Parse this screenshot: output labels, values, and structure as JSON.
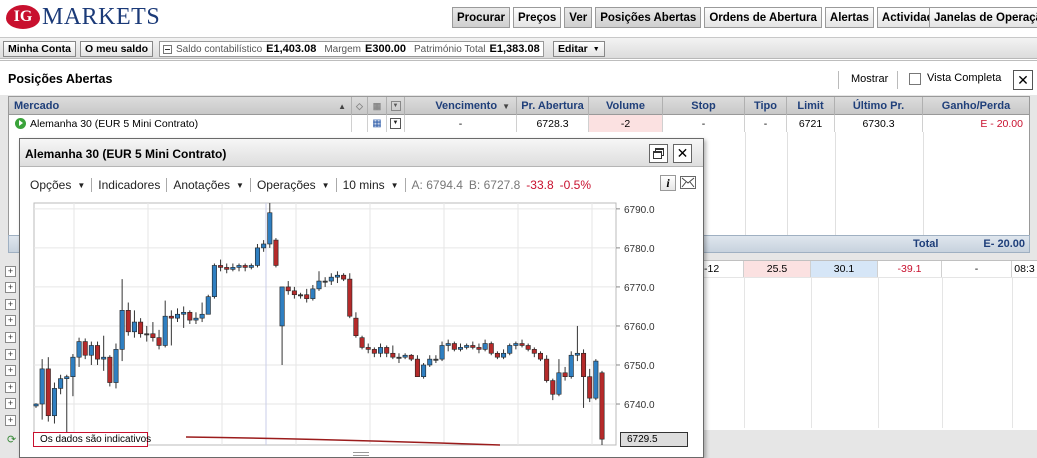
{
  "logo": {
    "mark": "IG",
    "text": "MARKETS"
  },
  "nav": [
    "Procurar",
    "Preços",
    "Ver",
    "Posições Abertas",
    "Ordens de Abertura",
    "Alertas",
    "Actividade"
  ],
  "nav_active": "Posições Abertas",
  "windows_menu": "Janelas de Operação",
  "account": {
    "my_account": "Minha Conta",
    "my_balance": "O meu saldo",
    "balance_label": "Saldo contabilístico",
    "balance_value": "E1,403.08",
    "margin_label": "Margem",
    "margin_value": "E300.00",
    "equity_label": "Património Total",
    "equity_value": "E1,383.08",
    "edit": "Editar"
  },
  "positions": {
    "title": "Posições Abertas",
    "show": "Mostrar",
    "full_view": "Vista Completa",
    "columns": [
      "Mercado",
      "Vencimento",
      "Pr. Abertura",
      "Volume",
      "Stop",
      "Tipo",
      "Limit",
      "Último Pr.",
      "Ganho/Perda"
    ],
    "row": {
      "market": "Alemanha 30 (EUR 5 Mini Contrato)",
      "expiry": "-",
      "open_price": "6728.3",
      "volume": "-2",
      "stop": "-",
      "type": "-",
      "limit": "6721",
      "last_price": "6730.3",
      "pnl": "E - 20.00"
    },
    "total_label": "Total",
    "total_value": "E- 20.00"
  },
  "orders_row": {
    "c1": "-12",
    "c2": "25.5",
    "c3": "30.1",
    "c4": "-39.1",
    "c5": "-",
    "c6": "08:3"
  },
  "chart_window": {
    "title": "Alemanha 30 (EUR 5 Mini Contrato)",
    "toolbar": {
      "options": "Opções",
      "indicators": "Indicadores",
      "annotations": "Anotações",
      "operations": "Operações",
      "interval": "10 mins",
      "ask": "A: 6794.4",
      "bid": "B: 6727.8",
      "change": "-33.8",
      "change_pct": "-0.5%"
    },
    "disclaimer": "Os dados são indicativos",
    "current_price": "6729.5"
  },
  "colors": {
    "up": "#2f7fc1",
    "down": "#b52a2a",
    "neutral": "#444444",
    "accent_red": "#c8102e",
    "header_blue": "#1f3f7a"
  },
  "chart_data": {
    "type": "candlestick",
    "title": "",
    "xlabel": "",
    "ylabel": "",
    "ylim": [
      6729.5,
      6791.5
    ],
    "yticks": [
      6790.0,
      6780.0,
      6770.0,
      6760.0,
      6750.0,
      6740.0
    ],
    "grid": true,
    "candles": [
      [
        6739.5,
        6740.2,
        6739.0,
        6740.0
      ],
      [
        6740.0,
        6751.5,
        6736.0,
        6749.0
      ],
      [
        6749.0,
        6752.0,
        6735.5,
        6737.0
      ],
      [
        6737.0,
        6745.5,
        6735.0,
        6744.0
      ],
      [
        6744.0,
        6747.5,
        6742.5,
        6746.5
      ],
      [
        6746.5,
        6747.5,
        6731.0,
        6747.0
      ],
      [
        6747.0,
        6752.8,
        6742.0,
        6752.0
      ],
      [
        6752.0,
        6757.0,
        6749.5,
        6756.0
      ],
      [
        6756.0,
        6756.8,
        6751.5,
        6752.5
      ],
      [
        6752.5,
        6756.0,
        6750.0,
        6755.0
      ],
      [
        6755.0,
        6756.0,
        6750.0,
        6751.5
      ],
      [
        6751.5,
        6757.5,
        6748.5,
        6752.0
      ],
      [
        6752.0,
        6752.5,
        6744.5,
        6745.5
      ],
      [
        6745.5,
        6755.5,
        6744.0,
        6754.0
      ],
      [
        6754.0,
        6772.0,
        6751.0,
        6764.0
      ],
      [
        6764.0,
        6766.0,
        6757.5,
        6758.5
      ],
      [
        6758.5,
        6764.0,
        6757.0,
        6761.0
      ],
      [
        6761.0,
        6762.0,
        6757.0,
        6758.0
      ],
      [
        6758.0,
        6760.0,
        6756.0,
        6758.0
      ],
      [
        6758.0,
        6761.0,
        6756.0,
        6757.0
      ],
      [
        6757.0,
        6759.0,
        6754.0,
        6755.0
      ],
      [
        6755.0,
        6766.5,
        6754.5,
        6762.5
      ],
      [
        6762.5,
        6764.0,
        6755.0,
        6762.0
      ],
      [
        6762.0,
        6764.5,
        6761.0,
        6763.0
      ],
      [
        6763.0,
        6765.0,
        6759.5,
        6763.5
      ],
      [
        6763.5,
        6764.0,
        6760.5,
        6761.5
      ],
      [
        6761.5,
        6763.5,
        6760.5,
        6762.0
      ],
      [
        6762.0,
        6766.0,
        6761.0,
        6763.0
      ],
      [
        6763.0,
        6768.0,
        6763.0,
        6767.5
      ],
      [
        6767.5,
        6776.0,
        6767.0,
        6775.5
      ],
      [
        6775.5,
        6777.0,
        6774.0,
        6775.0
      ],
      [
        6775.0,
        6776.0,
        6773.5,
        6774.5
      ],
      [
        6774.5,
        6776.0,
        6774.0,
        6775.0
      ],
      [
        6775.0,
        6776.0,
        6774.0,
        6775.5
      ],
      [
        6775.5,
        6776.0,
        6774.0,
        6775.0
      ],
      [
        6775.0,
        6776.0,
        6774.5,
        6775.5
      ],
      [
        6775.5,
        6781.0,
        6775.0,
        6780.0
      ],
      [
        6780.0,
        6782.0,
        6779.0,
        6781.0
      ],
      [
        6781.0,
        6791.5,
        6780.0,
        6789.0
      ],
      [
        6782.0,
        6782.5,
        6775.0,
        6775.5
      ],
      [
        6760.0,
        6770.0,
        6750.0,
        6770.0
      ],
      [
        6770.0,
        6771.5,
        6768.0,
        6769.0
      ],
      [
        6769.0,
        6770.0,
        6767.0,
        6768.0
      ],
      [
        6768.0,
        6768.5,
        6767.0,
        6768.0
      ],
      [
        6768.0,
        6769.5,
        6766.0,
        6767.0
      ],
      [
        6767.0,
        6770.5,
        6766.5,
        6769.5
      ],
      [
        6769.5,
        6774.0,
        6769.0,
        6771.5
      ],
      [
        6771.5,
        6772.5,
        6770.0,
        6771.5
      ],
      [
        6771.5,
        6773.5,
        6770.5,
        6772.5
      ],
      [
        6772.5,
        6774.0,
        6771.0,
        6773.0
      ],
      [
        6773.0,
        6773.5,
        6771.5,
        6772.0
      ],
      [
        6772.0,
        6773.5,
        6762.0,
        6762.5
      ],
      [
        6762.0,
        6763.5,
        6757.0,
        6757.5
      ],
      [
        6757.0,
        6757.5,
        6754.0,
        6754.5
      ],
      [
        6754.5,
        6755.5,
        6753.0,
        6754.0
      ],
      [
        6754.0,
        6754.5,
        6752.0,
        6753.0
      ],
      [
        6753.0,
        6755.5,
        6752.0,
        6754.5
      ],
      [
        6754.5,
        6755.0,
        6752.0,
        6753.0
      ],
      [
        6753.0,
        6755.0,
        6751.5,
        6752.0
      ],
      [
        6752.0,
        6753.0,
        6750.5,
        6752.0
      ],
      [
        6752.0,
        6753.0,
        6751.5,
        6752.5
      ],
      [
        6752.5,
        6752.8,
        6751.0,
        6751.5
      ],
      [
        6751.5,
        6752.5,
        6747.0,
        6747.0
      ],
      [
        6747.0,
        6750.5,
        6746.5,
        6750.0
      ],
      [
        6750.0,
        6752.5,
        6749.5,
        6751.5
      ],
      [
        6751.5,
        6752.5,
        6750.5,
        6751.5
      ],
      [
        6751.5,
        6756.0,
        6751.0,
        6755.0
      ],
      [
        6755.0,
        6756.5,
        6753.5,
        6755.5
      ],
      [
        6755.5,
        6756.0,
        6753.5,
        6754.0
      ],
      [
        6754.0,
        6755.5,
        6753.5,
        6754.5
      ],
      [
        6754.5,
        6755.5,
        6754.0,
        6755.0
      ],
      [
        6755.0,
        6756.0,
        6754.0,
        6754.5
      ],
      [
        6754.5,
        6755.5,
        6753.0,
        6754.0
      ],
      [
        6754.0,
        6756.5,
        6753.5,
        6755.5
      ],
      [
        6755.5,
        6756.0,
        6752.5,
        6753.0
      ],
      [
        6753.0,
        6753.5,
        6751.5,
        6752.0
      ],
      [
        6752.0,
        6754.0,
        6751.5,
        6753.0
      ],
      [
        6753.0,
        6755.5,
        6752.5,
        6755.0
      ],
      [
        6755.0,
        6756.0,
        6754.0,
        6755.5
      ],
      [
        6755.5,
        6756.5,
        6754.5,
        6755.0
      ],
      [
        6755.0,
        6755.5,
        6753.5,
        6754.0
      ],
      [
        6754.0,
        6754.5,
        6752.0,
        6753.0
      ],
      [
        6753.0,
        6753.5,
        6751.0,
        6751.5
      ],
      [
        6751.5,
        6752.5,
        6745.5,
        6746.0
      ],
      [
        6746.0,
        6746.5,
        6741.0,
        6742.5
      ],
      [
        6742.5,
        6751.5,
        6742.0,
        6748.0
      ],
      [
        6748.0,
        6749.5,
        6746.0,
        6747.0
      ],
      [
        6747.0,
        6753.5,
        6746.5,
        6752.5
      ],
      [
        6752.5,
        6760.0,
        6751.0,
        6753.0
      ],
      [
        6753.0,
        6754.0,
        6739.0,
        6747.0
      ],
      [
        6747.0,
        6749.0,
        6740.5,
        6741.5
      ],
      [
        6741.5,
        6751.5,
        6741.0,
        6751.0
      ],
      [
        6748.0,
        6748.5,
        6729.5,
        6731.0
      ]
    ]
  }
}
